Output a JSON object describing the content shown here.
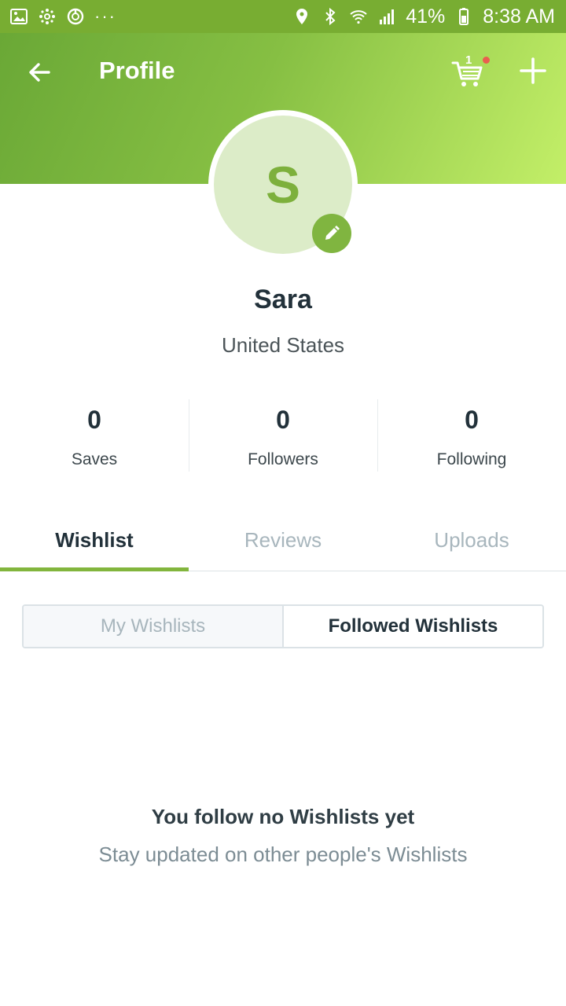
{
  "status_bar": {
    "left_icons": [
      "gallery-icon",
      "flower-icon",
      "ring-icon"
    ],
    "more_dots": "···",
    "battery": "41%",
    "time": "8:38 AM",
    "right_icons": [
      "location-icon",
      "bluetooth-icon",
      "wifi-icon",
      "signal-icon",
      "battery-icon"
    ]
  },
  "header": {
    "title": "Profile",
    "cart_count": "1",
    "colors": {
      "gradient_start": "#6aa836",
      "gradient_end": "#c3ef68",
      "status_bar": "#78ad32"
    }
  },
  "profile": {
    "avatar_initial": "S",
    "name": "Sara",
    "country": "United States"
  },
  "stats": [
    {
      "value": "0",
      "label": "Saves"
    },
    {
      "value": "0",
      "label": "Followers"
    },
    {
      "value": "0",
      "label": "Following"
    }
  ],
  "tabs": [
    {
      "label": "Wishlist",
      "active": true
    },
    {
      "label": "Reviews",
      "active": false
    },
    {
      "label": "Uploads",
      "active": false
    }
  ],
  "segment": {
    "options": [
      {
        "label": "My Wishlists",
        "active": false
      },
      {
        "label": "Followed Wishlists",
        "active": true
      }
    ]
  },
  "empty_state": {
    "title": "You follow no Wishlists yet",
    "subtitle": "Stay updated on other people's Wishlists"
  },
  "accent_color": "#82b53d"
}
